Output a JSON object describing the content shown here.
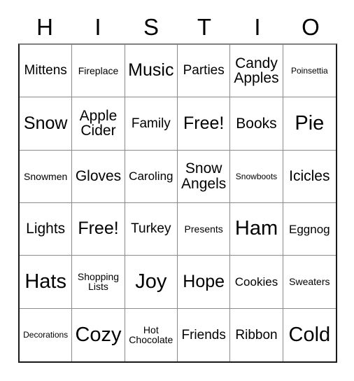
{
  "card": {
    "header_letters": [
      "H",
      "I",
      "S",
      "T",
      "I",
      "O"
    ],
    "columns": 6,
    "rows": 6,
    "text_color": "#000000",
    "background_color": "#ffffff",
    "border_color": "#8c8c8c",
    "outer_border_color": "#1a1a1a",
    "cells": [
      {
        "text": "Mittens",
        "size": "fs-ml"
      },
      {
        "text": "Fireplace",
        "size": "fs-s"
      },
      {
        "text": "Music",
        "size": "fs-xl"
      },
      {
        "text": "Parties",
        "size": "fs-ml"
      },
      {
        "text": "Candy\nApples",
        "size": "fs-l"
      },
      {
        "text": "Poinsettia",
        "size": "fs-xs"
      },
      {
        "text": "Snow",
        "size": "fs-xl"
      },
      {
        "text": "Apple\nCider",
        "size": "fs-l"
      },
      {
        "text": "Family",
        "size": "fs-ml"
      },
      {
        "text": "Free!",
        "size": "fs-xl"
      },
      {
        "text": "Books",
        "size": "fs-l"
      },
      {
        "text": "Pie",
        "size": "fs-xxl"
      },
      {
        "text": "Snowmen",
        "size": "fs-s"
      },
      {
        "text": "Gloves",
        "size": "fs-l"
      },
      {
        "text": "Caroling",
        "size": "fs-m"
      },
      {
        "text": "Snow\nAngels",
        "size": "fs-l"
      },
      {
        "text": "Snowboots",
        "size": "fs-xs"
      },
      {
        "text": "Icicles",
        "size": "fs-l"
      },
      {
        "text": "Lights",
        "size": "fs-l"
      },
      {
        "text": "Free!",
        "size": "fs-xl"
      },
      {
        "text": "Turkey",
        "size": "fs-ml"
      },
      {
        "text": "Presents",
        "size": "fs-s"
      },
      {
        "text": "Ham",
        "size": "fs-xxl"
      },
      {
        "text": "Eggnog",
        "size": "fs-m"
      },
      {
        "text": "Hats",
        "size": "fs-xxl"
      },
      {
        "text": "Shopping\nLists",
        "size": "fs-s"
      },
      {
        "text": "Joy",
        "size": "fs-xxl"
      },
      {
        "text": "Hope",
        "size": "fs-xl"
      },
      {
        "text": "Cookies",
        "size": "fs-m"
      },
      {
        "text": "Sweaters",
        "size": "fs-s"
      },
      {
        "text": "Decorations",
        "size": "fs-xs"
      },
      {
        "text": "Cozy",
        "size": "fs-xxl"
      },
      {
        "text": "Hot\nChocolate",
        "size": "fs-s"
      },
      {
        "text": "Friends",
        "size": "fs-ml"
      },
      {
        "text": "Ribbon",
        "size": "fs-ml"
      },
      {
        "text": "Cold",
        "size": "fs-xxl"
      }
    ]
  }
}
